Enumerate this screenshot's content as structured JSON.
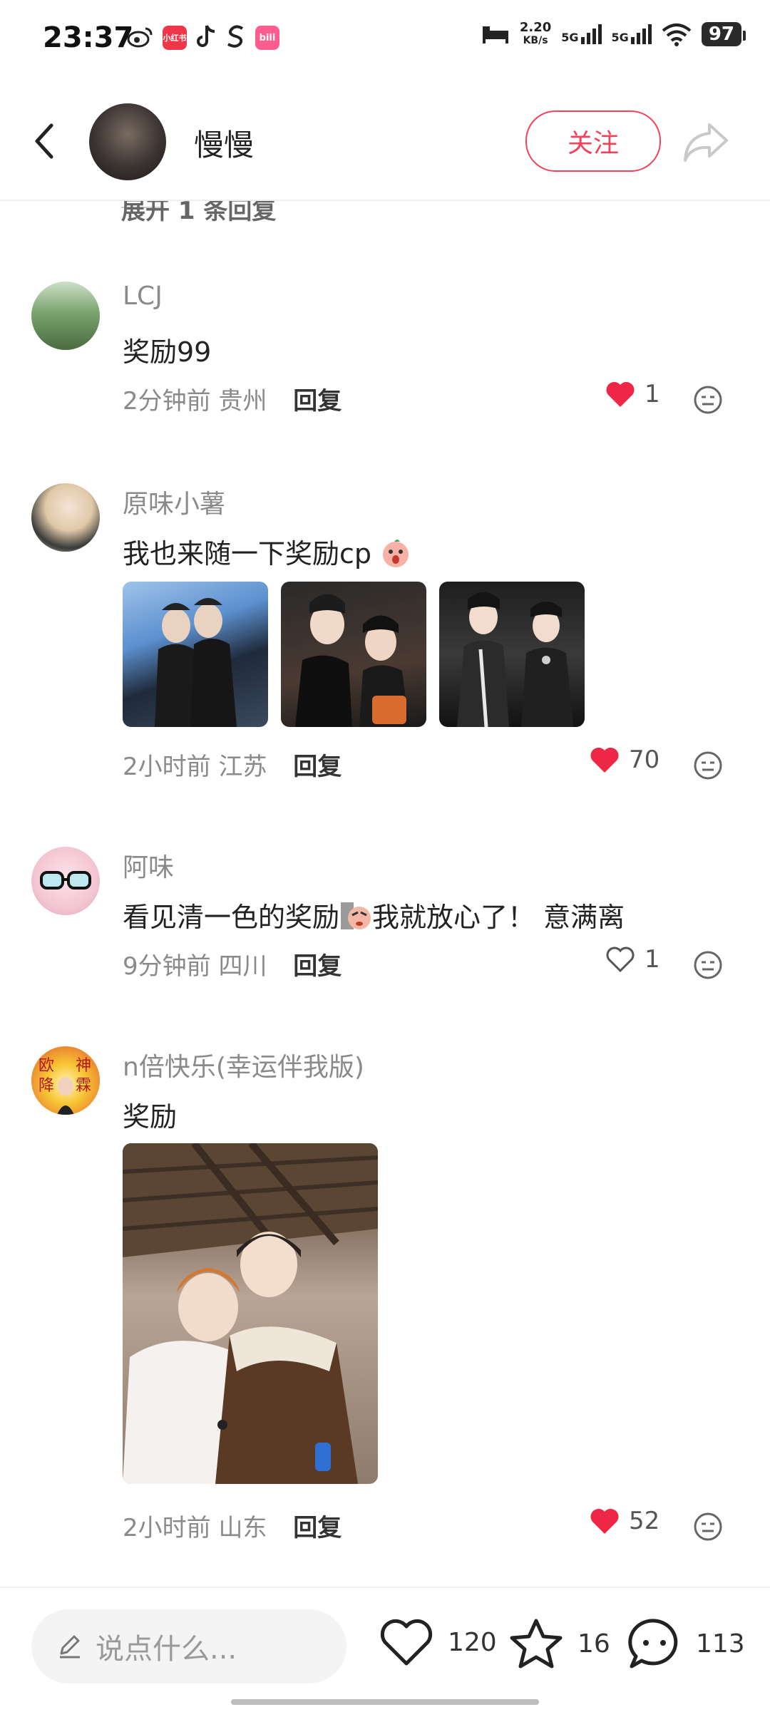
{
  "status_bar": {
    "time": "23:37",
    "app_icons": [
      "weibo-icon",
      "xiaohongshu-icon",
      "tiktok-icon",
      "soul-icon",
      "bilibili-icon"
    ],
    "xhs_label": "小红书",
    "bili_label": "bili",
    "speed_value": "2.20",
    "speed_unit": "KB/s",
    "net1": "5G",
    "net2": "5G",
    "battery": "97"
  },
  "header": {
    "username": "慢慢",
    "follow_label": "关注"
  },
  "expand_replies": "展开 1 条回复",
  "comments": [
    {
      "name": "LCJ",
      "text": "奖励99",
      "time": "2分钟前",
      "location": "贵州",
      "reply_label": "回复",
      "likes": "1",
      "liked": true
    },
    {
      "name": "原味小薯",
      "text": "我也来随一下奖励cp",
      "time": "2小时前",
      "location": "江苏",
      "reply_label": "回复",
      "likes": "70",
      "liked": true
    },
    {
      "name": "阿味",
      "text_part1": "看见清一色的奖励",
      "text_part2": "我就放心了！ 意满离",
      "time": "9分钟前",
      "location": "四川",
      "reply_label": "回复",
      "likes": "1",
      "liked": false
    },
    {
      "name": "n倍快乐(幸运伴我版)",
      "text": "奖励",
      "avatar_text": [
        "欧",
        "神",
        "降",
        "霖"
      ],
      "time": "2小时前",
      "location": "山东",
      "reply_label": "回复",
      "likes": "52",
      "liked": true
    }
  ],
  "bottom_bar": {
    "placeholder": "说点什么...",
    "likes": "120",
    "stars": "16",
    "comments": "113"
  },
  "colors": {
    "accent": "#f0445a",
    "like_red": "#ee2746",
    "meta_gray": "#8a8a8a"
  }
}
